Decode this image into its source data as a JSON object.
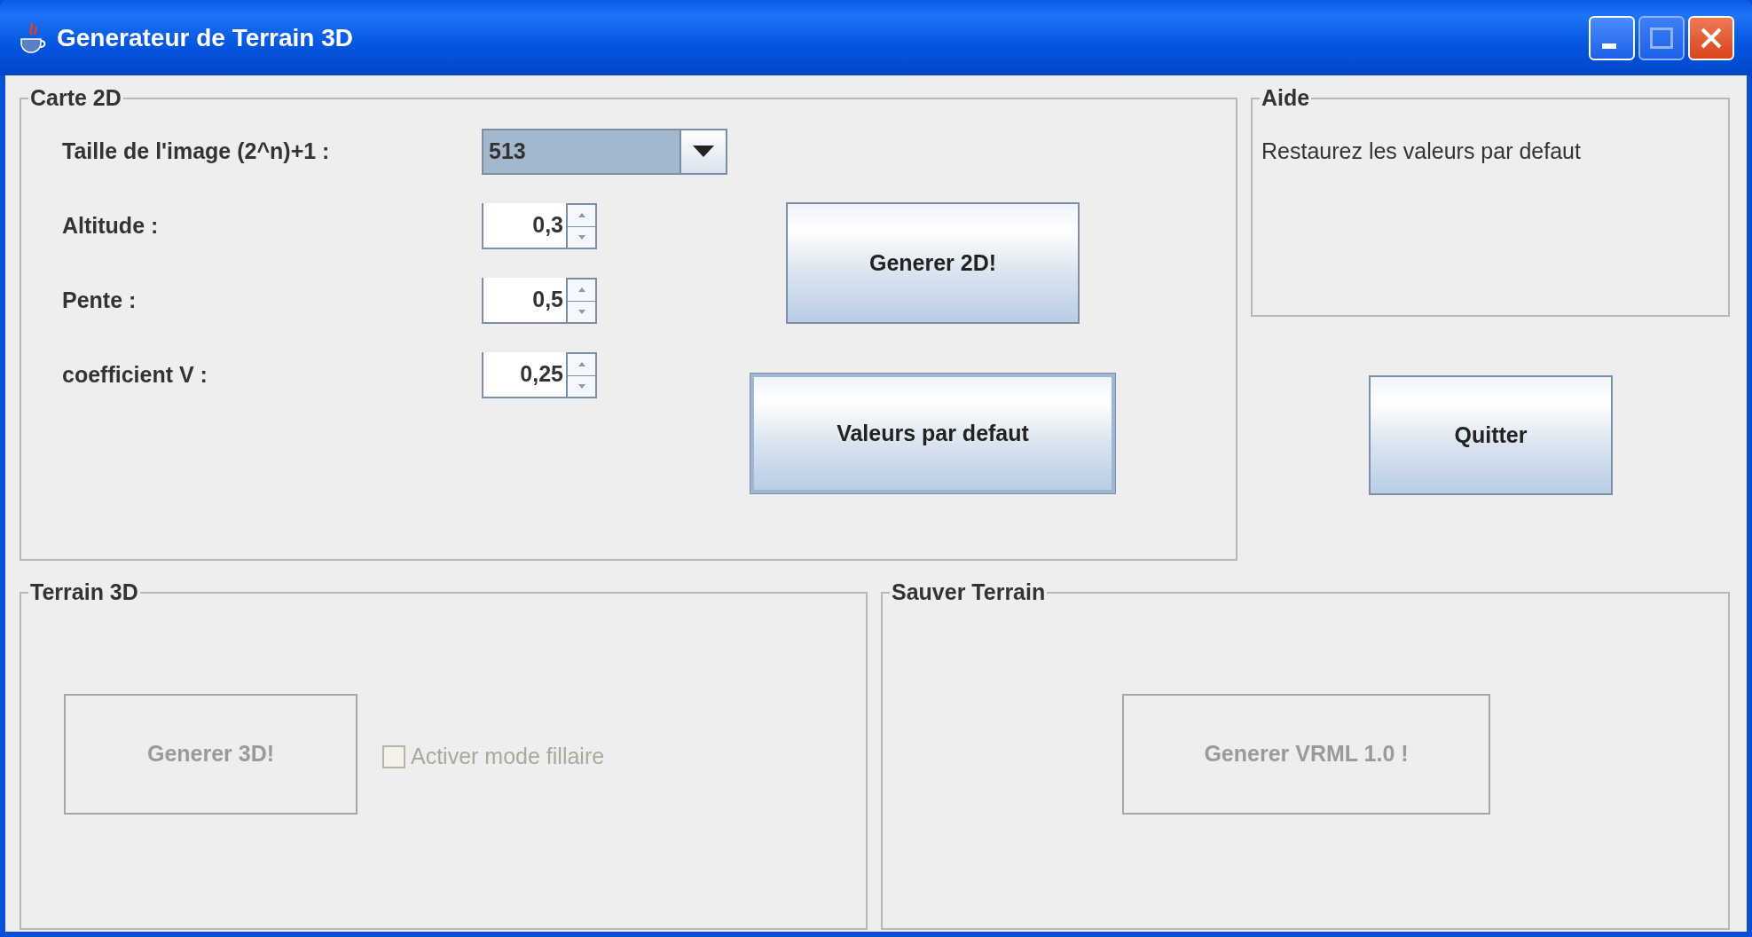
{
  "window": {
    "title": "Generateur de Terrain 3D"
  },
  "carte_2d": {
    "title": "Carte 2D",
    "fields": [
      {
        "kind": "combo",
        "label": "Taille de l'image (2^n)+1 :",
        "value": "513"
      },
      {
        "kind": "spinner",
        "label": "Altitude :",
        "value": "0,3"
      },
      {
        "kind": "spinner",
        "label": "Pente :",
        "value": "0,5"
      },
      {
        "kind": "spinner",
        "label": "coefficient V :",
        "value": "0,25"
      }
    ],
    "buttons": [
      {
        "label": "Generer 2D!",
        "focused": false
      },
      {
        "label": "Valeurs par defaut",
        "focused": true
      }
    ]
  },
  "aide": {
    "title": "Aide",
    "text": "Restaurez les valeurs par defaut"
  },
  "quit_button": {
    "label": "Quitter",
    "disabled": false
  },
  "terrain_3d": {
    "title": "Terrain 3D",
    "button": {
      "label": "Generer 3D!",
      "disabled": true
    },
    "checkbox": {
      "label": "Activer mode fillaire",
      "checked": false,
      "disabled": true
    }
  },
  "sauver_terrain": {
    "title": "Sauver Terrain",
    "button": {
      "label": "Generer VRML 1.0 !",
      "disabled": true
    }
  }
}
